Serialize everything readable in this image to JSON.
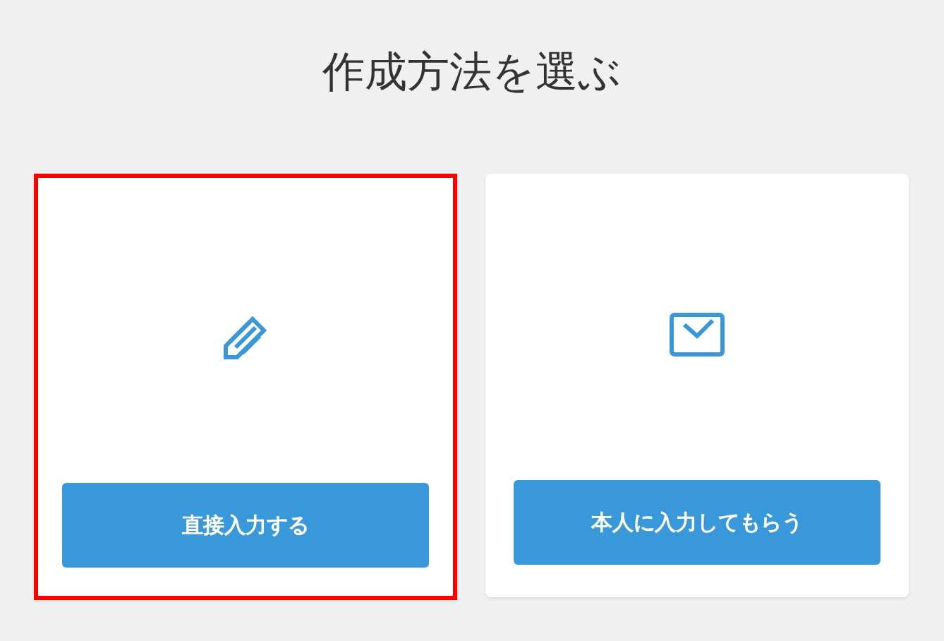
{
  "title": "作成方法を選ぶ",
  "options": [
    {
      "kind": "pencil",
      "button": "直接入力する",
      "selected": true
    },
    {
      "kind": "mail",
      "button": "本人に入力してもらう",
      "selected": false
    }
  ]
}
